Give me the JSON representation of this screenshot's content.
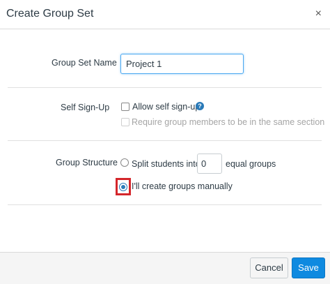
{
  "dialog": {
    "title": "Create Group Set",
    "close_symbol": "×"
  },
  "group_set_name": {
    "label": "Group Set Name",
    "value": "Project 1"
  },
  "self_signup": {
    "label": "Self Sign-Up",
    "allow_label": "Allow self sign-up",
    "help_symbol": "?",
    "require_label": "Require group members to be in the same section"
  },
  "group_structure": {
    "label": "Group Structure",
    "split_prefix": "Split students into",
    "split_count": "0",
    "split_suffix": "equal groups",
    "manual_label": "I'll create groups manually"
  },
  "footer": {
    "cancel_label": "Cancel",
    "save_label": "Save"
  },
  "colors": {
    "primary": "#0f8ae0",
    "highlight": "#d4262b",
    "help": "#2a7ab8"
  }
}
